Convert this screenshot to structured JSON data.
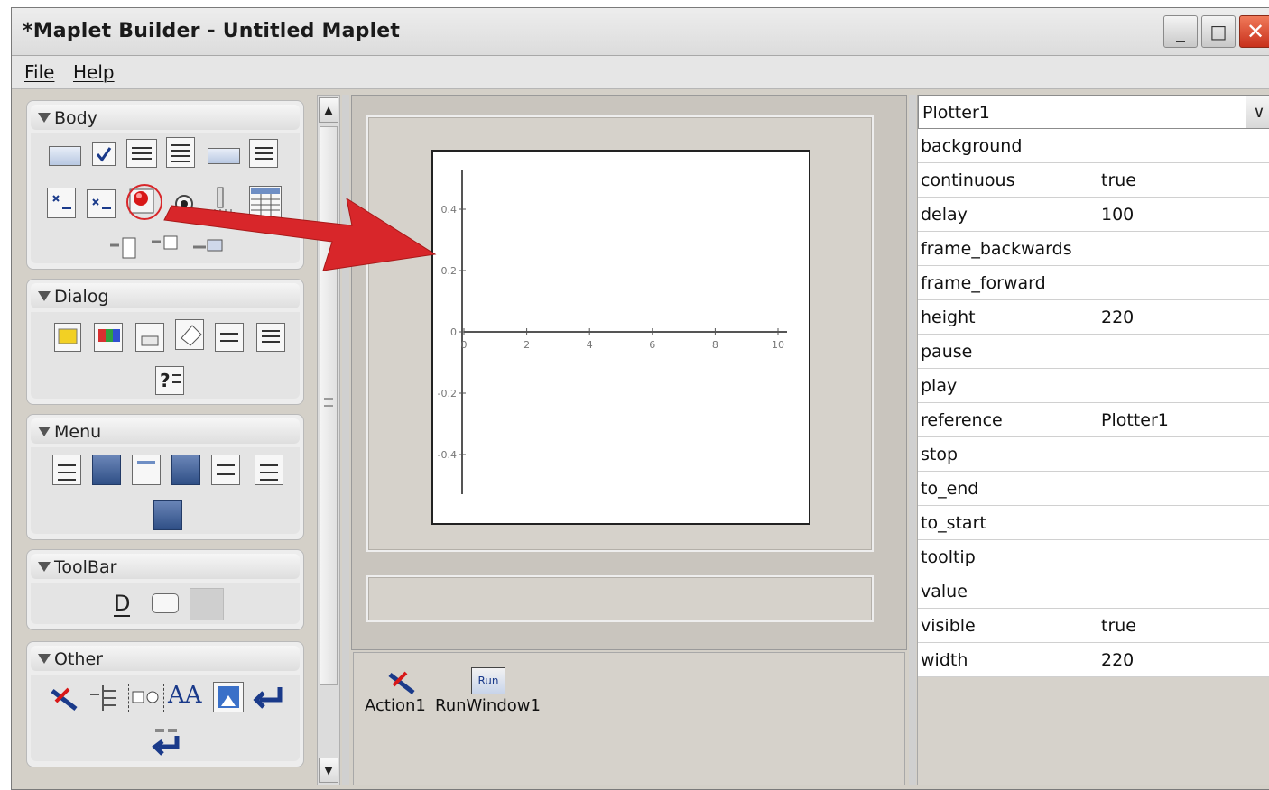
{
  "window": {
    "title": "*Maplet Builder - Untitled Maplet"
  },
  "window_controls": {
    "minimize": "_",
    "maximize": "□",
    "close": "✕"
  },
  "menu": [
    {
      "label": "File"
    },
    {
      "label": "Help"
    }
  ],
  "palette": {
    "sections": [
      {
        "title": "Body"
      },
      {
        "title": "Dialog"
      },
      {
        "title": "Menu"
      },
      {
        "title": "ToolBar"
      },
      {
        "title": "Other"
      }
    ],
    "scroll_up": "▲",
    "scroll_down": "▼",
    "dialog_help_glyph": "?",
    "other_text_glyph": "AA",
    "toolbar_label_glyph": "D",
    "run_glyph": "Run"
  },
  "plot": {
    "x_ticks": [
      "0",
      "2",
      "4",
      "6",
      "8",
      "10"
    ],
    "y_ticks": [
      "0.4",
      "0.2",
      "0",
      "-0.2",
      "-0.4"
    ]
  },
  "non_visual": [
    {
      "label": "Action1",
      "icon": "action-runner-icon"
    },
    {
      "label": "RunWindow1",
      "icon": "run-window-icon"
    }
  ],
  "properties": {
    "selected_component": "Plotter1",
    "dropdown_glyph": "∨",
    "rows": [
      {
        "name": "background",
        "value": ""
      },
      {
        "name": "continuous",
        "value": "true"
      },
      {
        "name": "delay",
        "value": "100"
      },
      {
        "name": "frame_backwards",
        "value": ""
      },
      {
        "name": "frame_forward",
        "value": ""
      },
      {
        "name": "height",
        "value": "220"
      },
      {
        "name": "pause",
        "value": ""
      },
      {
        "name": "play",
        "value": ""
      },
      {
        "name": "reference",
        "value": "Plotter1"
      },
      {
        "name": "stop",
        "value": ""
      },
      {
        "name": "to_end",
        "value": ""
      },
      {
        "name": "to_start",
        "value": ""
      },
      {
        "name": "tooltip",
        "value": ""
      },
      {
        "name": "value",
        "value": ""
      },
      {
        "name": "visible",
        "value": "true"
      },
      {
        "name": "width",
        "value": "220"
      }
    ]
  },
  "colors": {
    "annotation_arrow": "#d8262a",
    "highlight_circle": "#d8262a"
  }
}
